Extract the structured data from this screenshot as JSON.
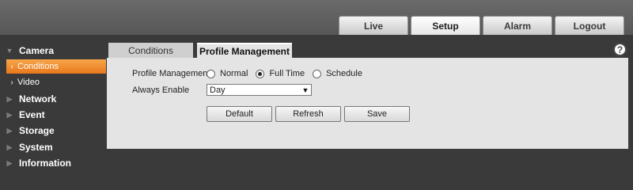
{
  "topnav": {
    "items": [
      {
        "label": "Live",
        "active": false
      },
      {
        "label": "Setup",
        "active": true
      },
      {
        "label": "Alarm",
        "active": false
      },
      {
        "label": "Logout",
        "active": false
      }
    ]
  },
  "sidebar": {
    "items": [
      {
        "label": "Camera",
        "expanded": true
      },
      {
        "label": "Network",
        "expanded": false
      },
      {
        "label": "Event",
        "expanded": false
      },
      {
        "label": "Storage",
        "expanded": false
      },
      {
        "label": "System",
        "expanded": false
      },
      {
        "label": "Information",
        "expanded": false
      }
    ],
    "camera_sub": [
      {
        "label": "Conditions",
        "active": true
      },
      {
        "label": "Video",
        "active": false
      }
    ]
  },
  "tabs": {
    "conditions": "Conditions",
    "profile_management": "Profile Management"
  },
  "help": {
    "glyph": "?"
  },
  "form": {
    "profile_label": "Profile Management",
    "options": [
      {
        "label": "Normal",
        "checked": false
      },
      {
        "label": "Full Time",
        "checked": true
      },
      {
        "label": "Schedule",
        "checked": false
      }
    ],
    "always_enable_label": "Always Enable",
    "always_enable_value": "Day"
  },
  "buttons": {
    "default": "Default",
    "refresh": "Refresh",
    "save": "Save"
  },
  "colors": {
    "accent": "#e8781c",
    "panel": "#e4e4e4",
    "background": "#3a3a3a"
  }
}
